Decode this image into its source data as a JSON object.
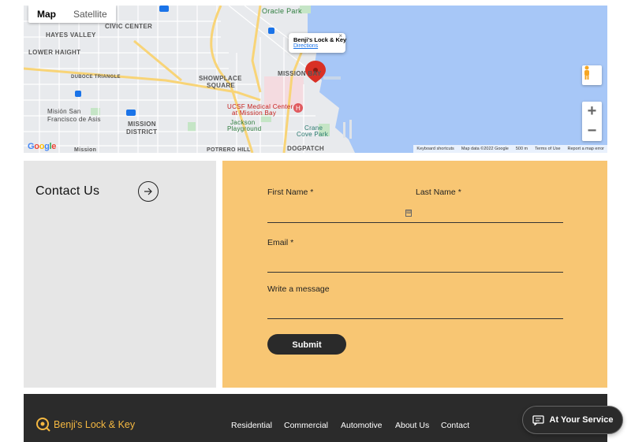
{
  "map": {
    "tabs": [
      {
        "label": "Map",
        "active": true
      },
      {
        "label": "Satellite",
        "active": false
      }
    ],
    "labels": {
      "hayes_valley": "HAYES VALLEY",
      "civic_center": "CIVIC CENTER",
      "lower_haight": "LOWER HAIGHT",
      "duboce": "DUBOCE TRIANGLE",
      "mission_dolores": "Misión San",
      "francisco": "Francisco de Asis",
      "mission_district": "MISSION",
      "mission_district2": "DISTRICT",
      "showplace": "SHOWPLACE",
      "square": "SQUARE",
      "mission_bay": "MISSION BAY",
      "oracle": "Oracle Park",
      "ucsf": "UCSF Medical Center",
      "ucsf2": "at Mission Bay",
      "jackson": "Jackson",
      "playground": "Playground",
      "crane": "Crane",
      "cove": "Cove Park",
      "dogpatch": "DOGPATCH",
      "potrero": "POTRERO HILL",
      "mission_bottom": "Mission"
    },
    "info_window": {
      "title": "Benji's Lock & Key",
      "link": "Directions",
      "close": "×"
    },
    "controls": {
      "zoom_in": "+",
      "zoom_out": "−",
      "pegman_icon": "pegman-icon"
    },
    "google_logo": "Google",
    "attribution": [
      "Keyboard shortcuts",
      "Map data ©2022 Google",
      "500 m",
      "Terms of Use",
      "Report a map error"
    ]
  },
  "contact": {
    "title": "Contact Us",
    "arrow_icon": "arrow-right-icon"
  },
  "form": {
    "first_name_label": "First Name *",
    "last_name_label": "Last Name *",
    "email_label": "Email *",
    "message_label": "Write a message",
    "first_name_value": "",
    "last_name_value": "",
    "email_value": "",
    "message_value": "",
    "submit_label": "Submit"
  },
  "footer": {
    "logo_text": "Benji's Lock & Key",
    "nav": [
      "Residential",
      "Commercial",
      "Automotive",
      "About Us",
      "Contact"
    ]
  },
  "chat": {
    "label": "At Your Service"
  },
  "colors": {
    "accent": "#f5b841",
    "form_bg": "#f8c673",
    "footer_bg": "#2b2b2b",
    "water": "#a7c7f7",
    "pin": "#d93025"
  }
}
